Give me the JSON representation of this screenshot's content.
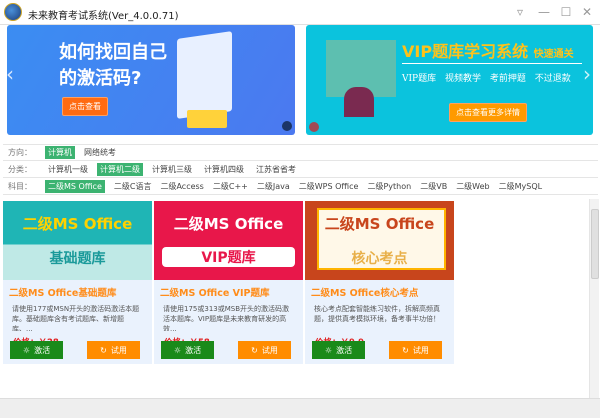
{
  "window": {
    "title": "未来教育考试系统(Ver_4.0.0.71)",
    "menu": "▿",
    "minimize": "—",
    "maximize": "☐",
    "close": "✕"
  },
  "banners": [
    {
      "headline": "如何找回自己的激活码?",
      "button": "点击查看"
    },
    {
      "headline": "VIP题库学习系统",
      "tag": "快速通关",
      "subtitle": "VIP题库 视频教学 考前押题 不过退款",
      "button": "点击查看更多详情"
    }
  ],
  "nav": {
    "prev": "‹",
    "next": "›"
  },
  "filters": {
    "direction": {
      "label": "方向：",
      "options": [
        "计算机",
        "网络统考"
      ],
      "selected": 0
    },
    "category": {
      "label": "分类：",
      "options": [
        "计算机一级",
        "计算机二级",
        "计算机三级",
        "计算机四级",
        "江苏省省考"
      ],
      "selected": 1
    },
    "subject": {
      "label": "科目：",
      "options": [
        "二级MS Office",
        "二级C语言",
        "二级Access",
        "二级C++",
        "二级Java",
        "二级WPS Office",
        "二级Python",
        "二级VB",
        "二级Web",
        "二级MySQL"
      ],
      "selected": 0
    }
  },
  "products": [
    {
      "img_line1": "二级MS Office",
      "img_line2": "基础题库",
      "title": "二级MS  Office基础题库",
      "desc": "请使用177或MSN开头的激活码激活本题库。基础题库含有考试题库、新增题库、...",
      "price": "价格：￥28",
      "activate": "激活",
      "trial": "试用"
    },
    {
      "img_line1": "二级MS Office",
      "img_line2": "VIP题库",
      "title": "二级MS  Office   VIP题库",
      "desc": "请使用175或313或MSB开头的激活码激活本题库。VIP题库是未来教育研发的高效...",
      "price": "价格：￥58",
      "activate": "激活",
      "trial": "试用"
    },
    {
      "img_line1": "二级MS Office",
      "img_line2": "核心考点",
      "title": "二级MS  Office核心考点",
      "desc": "核心考点配套智能练习软件，拆解高频真题，提供真考模拟环境，备考事半功倍！",
      "price": "价格：￥9.9",
      "activate": "激活",
      "trial": "试用"
    }
  ],
  "colors": {
    "accent": "#3cb371",
    "activate": "#1a8a1a",
    "trial": "#ff8c00",
    "price": "#e02020",
    "title": "#ff8c1a"
  }
}
